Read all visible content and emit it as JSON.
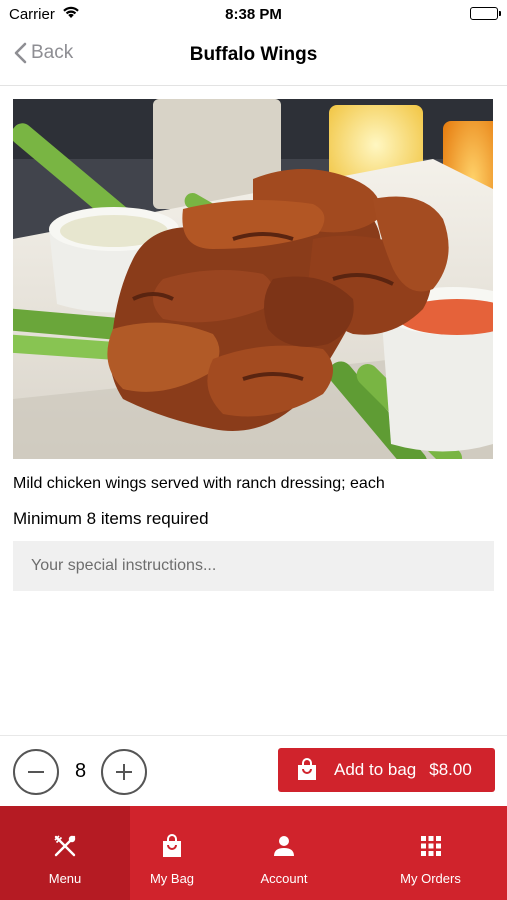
{
  "status_bar": {
    "carrier": "Carrier",
    "time": "8:38 PM"
  },
  "nav": {
    "back_label": "Back",
    "title": "Buffalo Wings"
  },
  "item": {
    "image_icon": "buffalo-wings-photo",
    "description": "Mild chicken wings served with ranch dressing; each",
    "minimum": "Minimum 8 items required",
    "instructions_placeholder": "Your special instructions..."
  },
  "order": {
    "quantity": "8",
    "add_to_bag_label": "Add to bag",
    "price": "$8.00"
  },
  "tabs": [
    {
      "label": "Menu",
      "icon": "fork-knife-icon",
      "active": true
    },
    {
      "label": "My Bag",
      "icon": "shopping-bag-icon",
      "active": false
    },
    {
      "label": "Account",
      "icon": "person-icon",
      "active": false
    },
    {
      "label": "My Orders",
      "icon": "grid-icon",
      "active": false
    }
  ],
  "colors": {
    "accent": "#d0232c",
    "accent_active": "#b51b23",
    "back_gray": "#8e8e93"
  }
}
